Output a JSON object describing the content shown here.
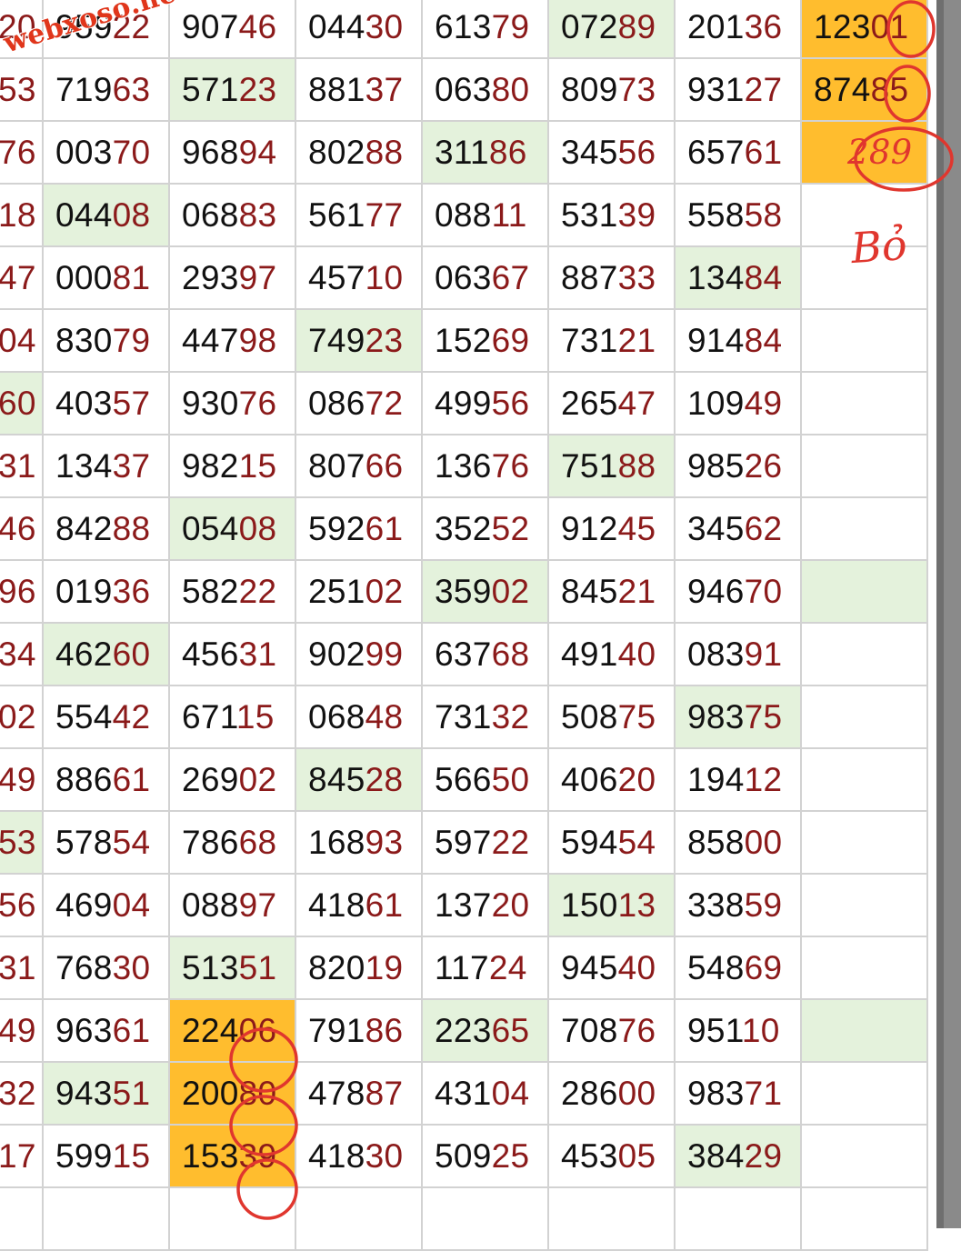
{
  "watermark": "webxoso.net",
  "handwritten_note": "Bỏ",
  "rows": [
    {
      "cells": [
        {
          "v": "20"
        },
        {
          "v": "95922"
        },
        {
          "v": "90746"
        },
        {
          "v": "04430"
        },
        {
          "v": "61379"
        },
        {
          "v": "07289",
          "hl": "green"
        },
        {
          "v": "20136"
        },
        {
          "v": "12301",
          "hl": "orange"
        }
      ]
    },
    {
      "cells": [
        {
          "v": "53"
        },
        {
          "v": "71963"
        },
        {
          "v": "57123",
          "hl": "green"
        },
        {
          "v": "88137"
        },
        {
          "v": "06380"
        },
        {
          "v": "80973"
        },
        {
          "v": "93127"
        },
        {
          "v": "87485",
          "hl": "orange"
        }
      ]
    },
    {
      "cells": [
        {
          "v": "76"
        },
        {
          "v": "00370"
        },
        {
          "v": "96894"
        },
        {
          "v": "80288"
        },
        {
          "v": "31186",
          "hl": "green"
        },
        {
          "v": "34556"
        },
        {
          "v": "65761"
        },
        {
          "v": "289",
          "hl": "orange",
          "hand": true
        }
      ]
    },
    {
      "cells": [
        {
          "v": "18"
        },
        {
          "v": "04408",
          "hl": "green"
        },
        {
          "v": "06883"
        },
        {
          "v": "56177"
        },
        {
          "v": "08811"
        },
        {
          "v": "53139"
        },
        {
          "v": "55858"
        },
        {
          "v": ""
        }
      ]
    },
    {
      "cells": [
        {
          "v": "47"
        },
        {
          "v": "00081"
        },
        {
          "v": "29397"
        },
        {
          "v": "45710"
        },
        {
          "v": "06367"
        },
        {
          "v": "88733"
        },
        {
          "v": "13484",
          "hl": "green"
        },
        {
          "v": ""
        }
      ]
    },
    {
      "cells": [
        {
          "v": "04"
        },
        {
          "v": "83079"
        },
        {
          "v": "44798"
        },
        {
          "v": "74923",
          "hl": "green"
        },
        {
          "v": "15269"
        },
        {
          "v": "73121"
        },
        {
          "v": "91484"
        },
        {
          "v": ""
        }
      ]
    },
    {
      "cells": [
        {
          "v": "60",
          "hl": "green"
        },
        {
          "v": "40357"
        },
        {
          "v": "93076"
        },
        {
          "v": "08672"
        },
        {
          "v": "49956"
        },
        {
          "v": "26547"
        },
        {
          "v": "10949"
        },
        {
          "v": ""
        }
      ]
    },
    {
      "cells": [
        {
          "v": "31"
        },
        {
          "v": "13437"
        },
        {
          "v": "98215"
        },
        {
          "v": "80766"
        },
        {
          "v": "13676"
        },
        {
          "v": "75188",
          "hl": "green"
        },
        {
          "v": "98526"
        },
        {
          "v": ""
        }
      ]
    },
    {
      "cells": [
        {
          "v": "46"
        },
        {
          "v": "84288"
        },
        {
          "v": "05408",
          "hl": "green"
        },
        {
          "v": "59261"
        },
        {
          "v": "35252"
        },
        {
          "v": "91245"
        },
        {
          "v": "34562"
        },
        {
          "v": ""
        }
      ]
    },
    {
      "cells": [
        {
          "v": "96"
        },
        {
          "v": "01936"
        },
        {
          "v": "58222"
        },
        {
          "v": "25102"
        },
        {
          "v": "35902",
          "hl": "green"
        },
        {
          "v": "84521"
        },
        {
          "v": "94670"
        },
        {
          "v": "",
          "hl": "green"
        }
      ]
    },
    {
      "cells": [
        {
          "v": "34"
        },
        {
          "v": "46260",
          "hl": "green"
        },
        {
          "v": "45631"
        },
        {
          "v": "90299"
        },
        {
          "v": "63768"
        },
        {
          "v": "49140"
        },
        {
          "v": "08391"
        },
        {
          "v": ""
        }
      ]
    },
    {
      "cells": [
        {
          "v": "02"
        },
        {
          "v": "55442"
        },
        {
          "v": "67115"
        },
        {
          "v": "06848"
        },
        {
          "v": "73132"
        },
        {
          "v": "50875"
        },
        {
          "v": "98375",
          "hl": "green"
        },
        {
          "v": ""
        }
      ]
    },
    {
      "cells": [
        {
          "v": "49"
        },
        {
          "v": "88661"
        },
        {
          "v": "26902"
        },
        {
          "v": "84528",
          "hl": "green"
        },
        {
          "v": "56650"
        },
        {
          "v": "40620"
        },
        {
          "v": "19412"
        },
        {
          "v": ""
        }
      ]
    },
    {
      "cells": [
        {
          "v": "53",
          "hl": "green"
        },
        {
          "v": "57854"
        },
        {
          "v": "78668"
        },
        {
          "v": "16893"
        },
        {
          "v": "59722"
        },
        {
          "v": "59454"
        },
        {
          "v": "85800"
        },
        {
          "v": ""
        }
      ]
    },
    {
      "cells": [
        {
          "v": "56"
        },
        {
          "v": "46904"
        },
        {
          "v": "08897"
        },
        {
          "v": "41861"
        },
        {
          "v": "13720"
        },
        {
          "v": "15013",
          "hl": "green"
        },
        {
          "v": "33859"
        },
        {
          "v": ""
        }
      ]
    },
    {
      "cells": [
        {
          "v": "31"
        },
        {
          "v": "76830"
        },
        {
          "v": "51351",
          "hl": "green"
        },
        {
          "v": "82019"
        },
        {
          "v": "11724"
        },
        {
          "v": "94540"
        },
        {
          "v": "54869"
        },
        {
          "v": ""
        }
      ]
    },
    {
      "cells": [
        {
          "v": "49"
        },
        {
          "v": "96361"
        },
        {
          "v": "22406",
          "hl": "orange"
        },
        {
          "v": "79186"
        },
        {
          "v": "22365",
          "hl": "green"
        },
        {
          "v": "70876"
        },
        {
          "v": "95110"
        },
        {
          "v": "",
          "hl": "green"
        }
      ]
    },
    {
      "cells": [
        {
          "v": "32"
        },
        {
          "v": "94351",
          "hl": "green"
        },
        {
          "v": "20080",
          "hl": "orange"
        },
        {
          "v": "47887"
        },
        {
          "v": "43104"
        },
        {
          "v": "28600"
        },
        {
          "v": "98371"
        },
        {
          "v": ""
        }
      ]
    },
    {
      "cells": [
        {
          "v": "17"
        },
        {
          "v": "59915"
        },
        {
          "v": "15339",
          "hl": "orange"
        },
        {
          "v": "41830"
        },
        {
          "v": "50925"
        },
        {
          "v": "45305"
        },
        {
          "v": "38429",
          "hl": "green"
        },
        {
          "v": ""
        }
      ]
    },
    {
      "cells": [
        {
          "v": ""
        },
        {
          "v": ""
        },
        {
          "v": ""
        },
        {
          "v": ""
        },
        {
          "v": ""
        },
        {
          "v": ""
        },
        {
          "v": ""
        },
        {
          "v": ""
        }
      ]
    }
  ],
  "colors": {
    "grid_line": "#d2d2d2",
    "highlight_green": "#e4f2dc",
    "highlight_orange": "#ffbd2e",
    "tail_digits": "#8b1a1a",
    "marker_red": "#e0362e"
  }
}
